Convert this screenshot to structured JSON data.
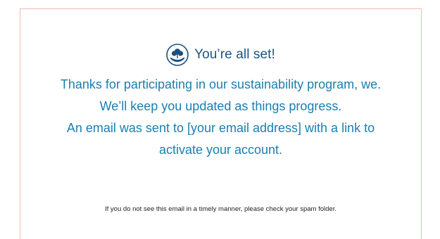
{
  "header": {
    "logo_icon": "cotton-plant-in-hand-icon",
    "title": "You’re all set!"
  },
  "message": {
    "line1": "Thanks for participating in our sustainability program, we. We’ll keep you updated as things progress.",
    "line2": "An email was sent to [your email address] with a link to activate your account."
  },
  "note": {
    "text": "If you do not see this email in a timely manner, please check your spam folder."
  },
  "colors": {
    "title": "#1c5480",
    "message": "#1a7fb0",
    "border": "#f2b8b5",
    "icon": "#1c4f7c"
  }
}
